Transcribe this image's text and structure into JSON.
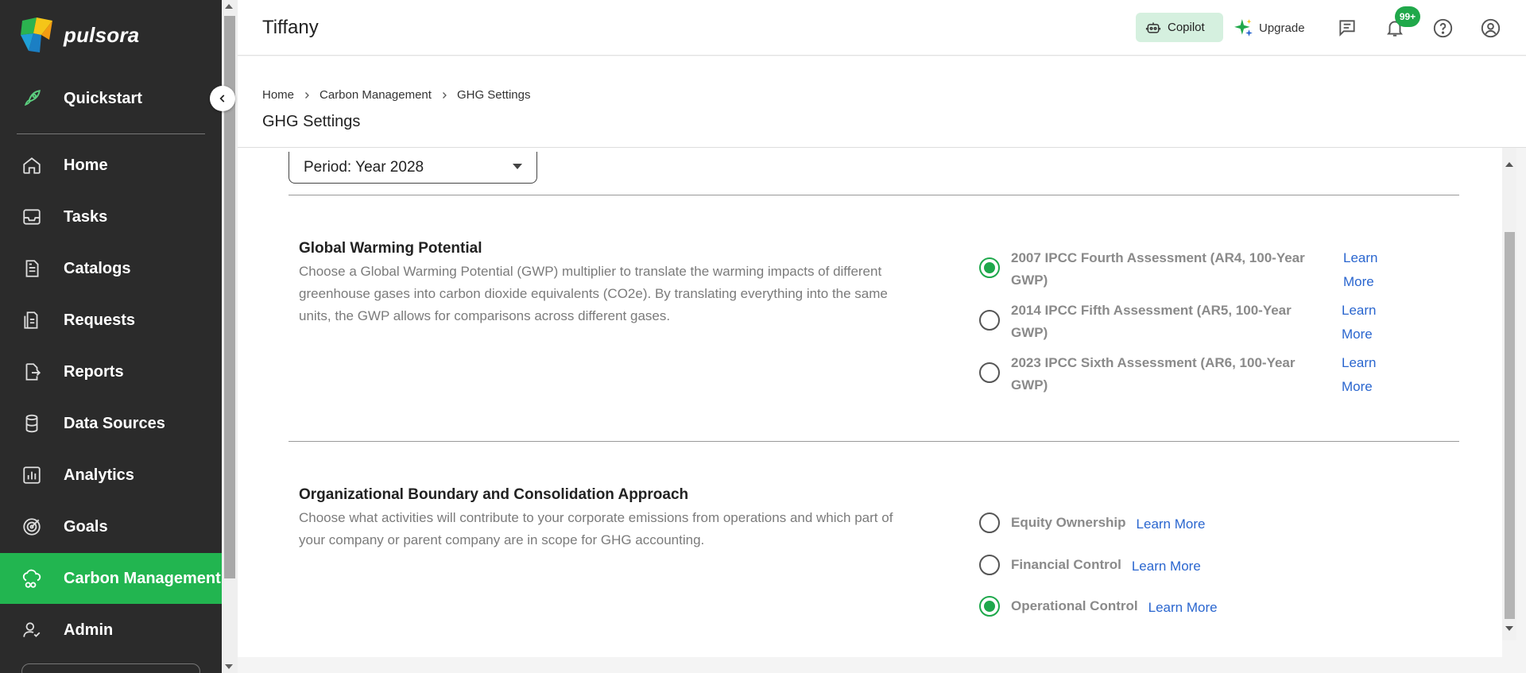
{
  "app": {
    "brand": "pulsora",
    "accent": "#22b550"
  },
  "sidebar": {
    "items": [
      {
        "label": "Quickstart",
        "icon": "rocket-icon"
      },
      {
        "label": "Home",
        "icon": "home-icon"
      },
      {
        "label": "Tasks",
        "icon": "inbox-icon"
      },
      {
        "label": "Catalogs",
        "icon": "document-icon"
      },
      {
        "label": "Requests",
        "icon": "requests-icon"
      },
      {
        "label": "Reports",
        "icon": "export-icon"
      },
      {
        "label": "Data Sources",
        "icon": "database-icon"
      },
      {
        "label": "Analytics",
        "icon": "bar-chart-icon"
      },
      {
        "label": "Goals",
        "icon": "target-icon"
      },
      {
        "label": "Carbon Management",
        "icon": "cloud-co2-icon",
        "active": true
      },
      {
        "label": "Admin",
        "icon": "user-admin-icon"
      }
    ]
  },
  "topbar": {
    "user_name": "Tiffany",
    "copilot_label": "Copilot",
    "upgrade_label": "Upgrade",
    "notification_badge": "99+"
  },
  "breadcrumb": [
    "Home",
    "Carbon Management",
    "GHG Settings"
  ],
  "page_title": "GHG Settings",
  "period": {
    "label": "Period: Year 2028"
  },
  "gwp": {
    "title": "Global Warming Potential",
    "description": "Choose a Global Warming Potential (GWP) multiplier to translate the warming impacts of different greenhouse gases into carbon dioxide equivalents (CO2e). By translating everything into the same units, the GWP allows for comparisons across different gases.",
    "options": [
      {
        "line1": "2007 IPCC Fourth Assessment (AR4, 100-Year",
        "line2": "GWP)",
        "learn1": "Learn",
        "learn2": "More",
        "checked": true
      },
      {
        "line1": "2014 IPCC Fifth Assessment (AR5, 100-Year",
        "line2": "GWP)",
        "learn1": "Learn",
        "learn2": "More",
        "checked": false
      },
      {
        "line1": "2023 IPCC Sixth Assessment (AR6, 100-Year",
        "line2": "GWP)",
        "learn1": "Learn",
        "learn2": "More",
        "checked": false
      }
    ]
  },
  "boundary": {
    "title": "Organizational Boundary and Consolidation Approach",
    "description": "Choose what activities will contribute to your corporate emissions from operations and which part of your company or parent company are in scope for GHG accounting.",
    "options": [
      {
        "label": "Equity Ownership",
        "learn": "Learn More",
        "checked": false
      },
      {
        "label": "Financial Control",
        "learn": "Learn More",
        "checked": false
      },
      {
        "label": "Operational Control",
        "learn": "Learn More",
        "checked": true
      }
    ]
  }
}
